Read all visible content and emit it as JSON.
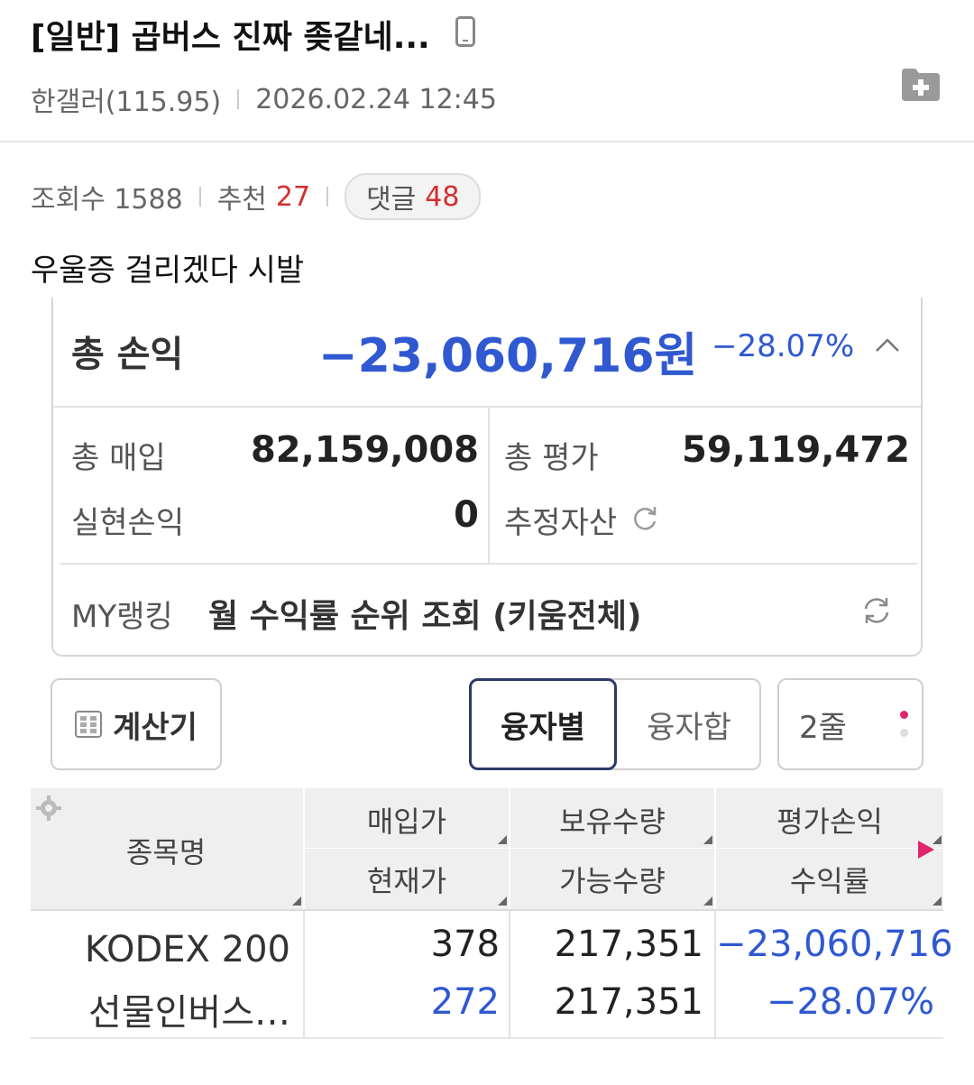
{
  "post": {
    "title": "[일반] 곱버스 진짜 좆같네...",
    "author": "한갤러(115.95)",
    "datetime": "2026.02.24 12:45",
    "views_label": "조회수 1588",
    "recommend_label": "추천",
    "recommend_count": "27",
    "comment_label": "댓글",
    "comment_count": "48",
    "body": "우울증 걸리겠다 시발"
  },
  "portfolio": {
    "total_pl_label": "총 손익",
    "total_pl_value": "−23,060,716원",
    "total_pl_rate": "−28.07%",
    "buy_label": "총 매입",
    "buy_value": "82,159,008",
    "eval_label": "총 평가",
    "eval_value": "59,119,472",
    "realized_label": "실현손익",
    "realized_value": "0",
    "est_label": "추정자산",
    "ranking_prefix": "MY랭킹",
    "ranking_text": "월 수익률 순위 조회 (키움전체)",
    "buttons": {
      "calculator": "계산기",
      "by_loan": "융자별",
      "loan_sum": "융자합",
      "rows": "2줄"
    },
    "table": {
      "headers": {
        "name": "종목명",
        "buy_price": "매입가",
        "current_price": "현재가",
        "holding_qty": "보유수량",
        "available_qty": "가능수량",
        "eval_pl": "평가손익",
        "return_rate": "수익률"
      },
      "rows": [
        {
          "name_line1": "KODEX 200",
          "name_line2": "선물인버스…",
          "buy_price": "378",
          "current_price": "272",
          "holding_qty": "217,351",
          "available_qty": "217,351",
          "eval_pl": "−23,060,716",
          "return_rate": "−28.07%"
        }
      ]
    }
  },
  "colors": {
    "negative": "#2f58d1",
    "recommend": "#d32f2f",
    "accent_arrow": "#e0246e"
  }
}
